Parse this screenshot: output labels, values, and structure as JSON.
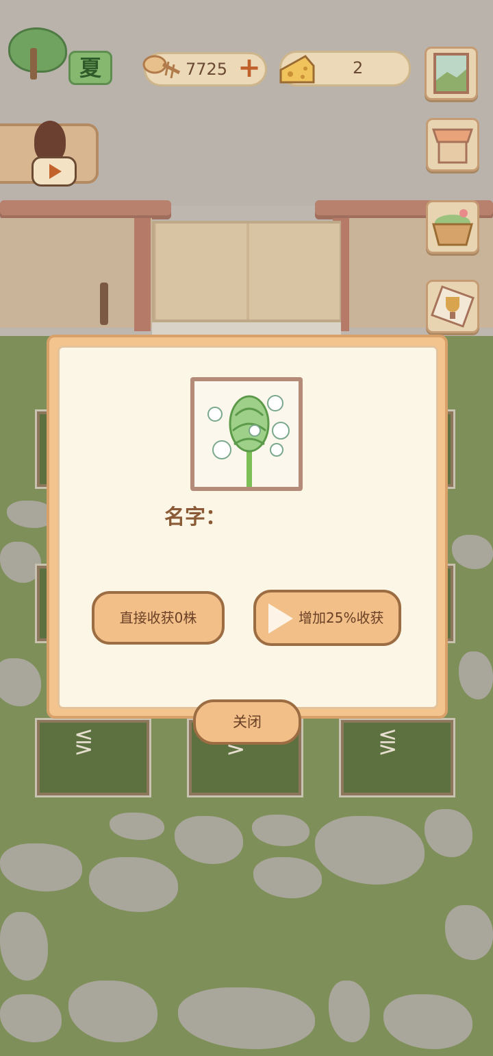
{
  "hud": {
    "season": {
      "label": "夏",
      "icon": "tree-icon"
    },
    "fish_currency": {
      "icon": "fish-bone-icon",
      "value": "7725",
      "add_icon": "plus-icon",
      "add_label": "+"
    },
    "cheese_currency": {
      "icon": "cheese-icon",
      "value": "2"
    }
  },
  "side_menu": [
    {
      "id": "window",
      "icon": "window-landscape-icon"
    },
    {
      "id": "shop",
      "icon": "market-stall-icon"
    },
    {
      "id": "basket",
      "icon": "vegetable-basket-icon"
    },
    {
      "id": "achievement",
      "icon": "trophy-badge-icon"
    }
  ],
  "video_reward": {
    "icon": "play-icon"
  },
  "dialog": {
    "plant_icon": "white-flower-bud-plant-icon",
    "name_label": "名字：",
    "name_value": "",
    "harvest_button": "直接收获0株",
    "boost_button": "增加25%收获",
    "boost_icon": "play-icon",
    "close_button": "关闭"
  },
  "colors": {
    "dialog_border": "#f3c48d",
    "dialog_bg": "#fcf6e6",
    "button_fill": "#f2bf88",
    "button_stroke": "#9c6c43",
    "text_brown": "#6a4026",
    "lawn": "#7f8f5a"
  }
}
